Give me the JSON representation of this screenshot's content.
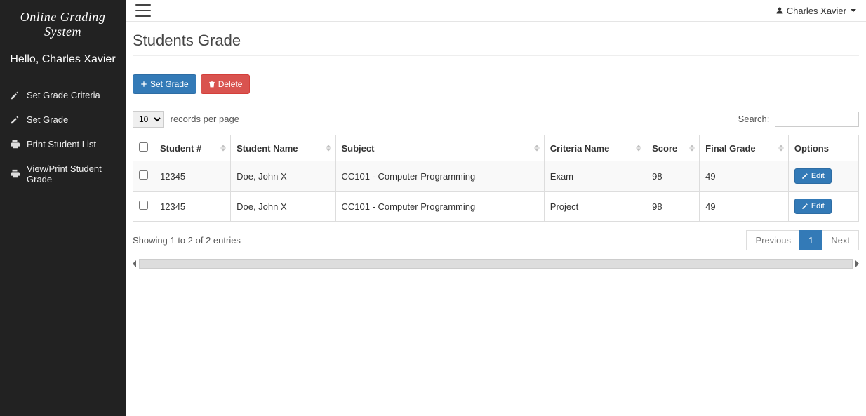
{
  "app_name": "Online Grading System",
  "greeting": "Hello, Charles Xavier",
  "user_name": "Charles Xavier",
  "sidebar": {
    "items": [
      {
        "label": "Set Grade Criteria",
        "icon": "edit"
      },
      {
        "label": "Set Grade",
        "icon": "edit"
      },
      {
        "label": "Print Student List",
        "icon": "print"
      },
      {
        "label": "View/Print Student Grade",
        "icon": "print"
      }
    ]
  },
  "page": {
    "title": "Students Grade",
    "set_grade_button": "Set Grade",
    "delete_button": "Delete",
    "records_per_page_label": "records per page",
    "records_per_page_value": "10",
    "search_label": "Search:",
    "search_value": "",
    "table": {
      "columns": [
        "Student #",
        "Student Name",
        "Subject",
        "Criteria Name",
        "Score",
        "Final Grade",
        "Options"
      ],
      "rows": [
        {
          "student_no": "12345",
          "student_name": "Doe, John X",
          "subject": "CC101 - Computer Programming",
          "criteria": "Exam",
          "score": "98",
          "final_grade": "49",
          "edit_label": "Edit"
        },
        {
          "student_no": "12345",
          "student_name": "Doe, John X",
          "subject": "CC101 - Computer Programming",
          "criteria": "Project",
          "score": "98",
          "final_grade": "49",
          "edit_label": "Edit"
        }
      ]
    },
    "showing_info": "Showing 1 to 2 of 2 entries",
    "pagination": {
      "previous": "Previous",
      "next": "Next",
      "current": "1"
    }
  }
}
